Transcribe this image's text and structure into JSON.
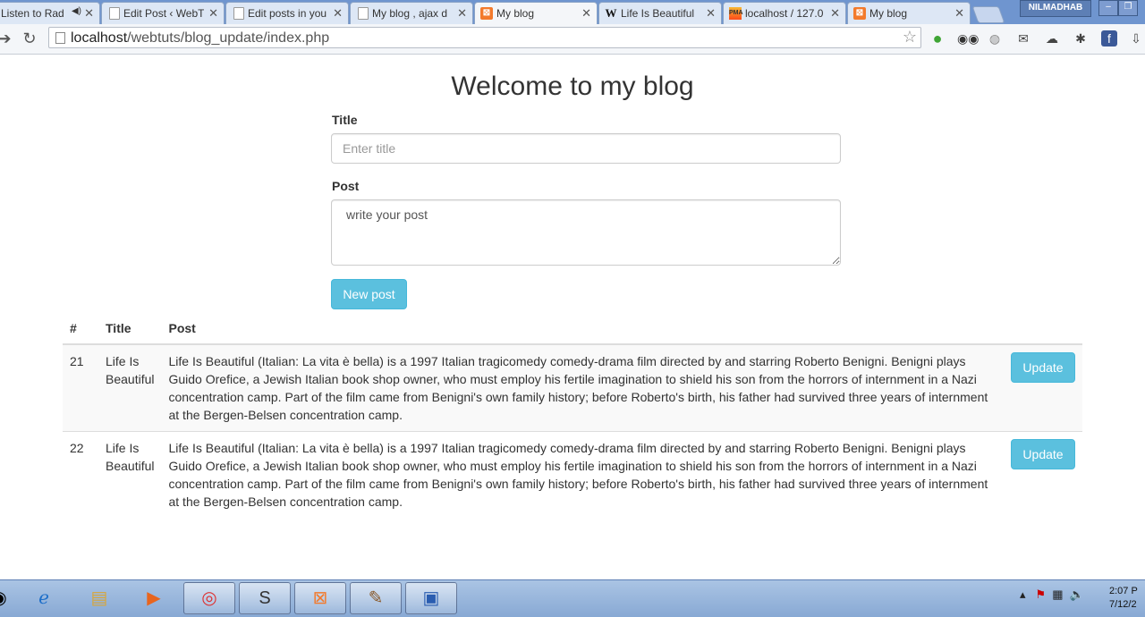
{
  "browser": {
    "tabs": [
      {
        "title": "Listen to Rad",
        "icon": "radio-icon"
      },
      {
        "title": "Edit Post ‹ WebT",
        "icon": "page-icon"
      },
      {
        "title": "Edit posts in you",
        "icon": "page-icon"
      },
      {
        "title": "My blog , ajax d",
        "icon": "page-icon"
      },
      {
        "title": "My blog",
        "icon": "xampp-icon"
      },
      {
        "title": "Life Is Beautiful",
        "icon": "wikipedia-icon"
      },
      {
        "title": "localhost / 127.0",
        "icon": "phpmyadmin-icon"
      },
      {
        "title": "My blog",
        "icon": "xampp-icon"
      }
    ],
    "user": "NILMADHAB",
    "url_host": "localhost",
    "url_path": "/webtuts/blog_update/index.php"
  },
  "page": {
    "heading": "Welcome to my blog",
    "title_label": "Title",
    "title_placeholder": "Enter title",
    "post_label": "Post",
    "post_placeholder": "write your post",
    "new_post_label": "New post"
  },
  "table": {
    "headers": [
      "#",
      "Title",
      "Post"
    ],
    "rows": [
      {
        "id": "21",
        "title": "Life Is Beautiful",
        "post": "Life Is Beautiful (Italian: La vita è bella) is a 1997 Italian tragicomedy comedy-drama film directed by and starring Roberto Benigni. Benigni plays Guido Orefice, a Jewish Italian book shop owner, who must employ his fertile imagination to shield his son from the horrors of internment in a Nazi concentration camp. Part of the film came from Benigni's own family history; before Roberto's birth, his father had survived three years of internment at the Bergen-Belsen concentration camp.",
        "action": "Update"
      },
      {
        "id": "22",
        "title": "Life Is Beautiful",
        "post": "Life Is Beautiful (Italian: La vita è bella) is a 1997 Italian tragicomedy comedy-drama film directed by and starring Roberto Benigni. Benigni plays Guido Orefice, a Jewish Italian book shop owner, who must employ his fertile imagination to shield his son from the horrors of internment in a Nazi concentration camp. Part of the film came from Benigni's own family history; before Roberto's birth, his father had survived three years of internment at the Bergen-Belsen concentration camp.",
        "action": "Update"
      }
    ]
  },
  "taskbar": {
    "clock_time": "2:07 P",
    "clock_date": "7/12/2"
  },
  "colors": {
    "accent": "#5bc0de",
    "taskbar": "#99b8df"
  }
}
